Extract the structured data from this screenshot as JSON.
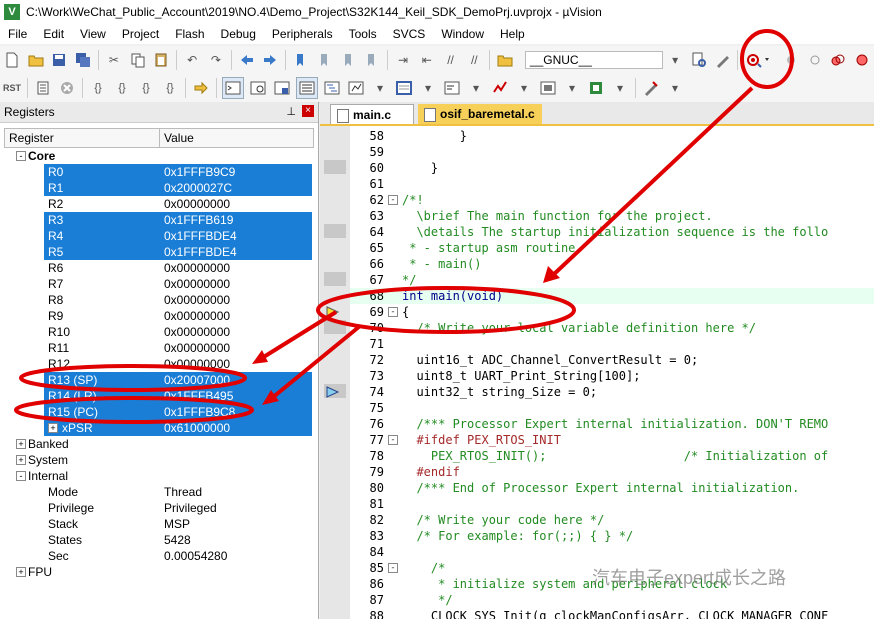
{
  "window": {
    "title": "C:\\Work\\WeChat_Public_Account\\2019\\NO.4\\Demo_Project\\S32K144_Keil_SDK_DemoPrj.uvprojx - µVision"
  },
  "menu": [
    "File",
    "Edit",
    "View",
    "Project",
    "Flash",
    "Debug",
    "Peripherals",
    "Tools",
    "SVCS",
    "Window",
    "Help"
  ],
  "toolbar": {
    "target_value": "__GNUC__"
  },
  "registers_pane": {
    "title": "Registers",
    "columns": {
      "register": "Register",
      "value": "Value"
    },
    "core_label": "Core",
    "core": [
      {
        "name": "R0",
        "value": "0x1FFFB9C9",
        "selected": true
      },
      {
        "name": "R1",
        "value": "0x2000027C",
        "selected": true
      },
      {
        "name": "R2",
        "value": "0x00000000",
        "selected": false
      },
      {
        "name": "R3",
        "value": "0x1FFFB619",
        "selected": true
      },
      {
        "name": "R4",
        "value": "0x1FFFBDE4",
        "selected": true
      },
      {
        "name": "R5",
        "value": "0x1FFFBDE4",
        "selected": true
      },
      {
        "name": "R6",
        "value": "0x00000000",
        "selected": false
      },
      {
        "name": "R7",
        "value": "0x00000000",
        "selected": false
      },
      {
        "name": "R8",
        "value": "0x00000000",
        "selected": false
      },
      {
        "name": "R9",
        "value": "0x00000000",
        "selected": false
      },
      {
        "name": "R10",
        "value": "0x00000000",
        "selected": false
      },
      {
        "name": "R11",
        "value": "0x00000000",
        "selected": false
      },
      {
        "name": "R12",
        "value": "0x00000000",
        "selected": false
      },
      {
        "name": "R13 (SP)",
        "value": "0x20007000",
        "selected": true
      },
      {
        "name": "R14 (LR)",
        "value": "0x1FFFB495",
        "selected": true
      },
      {
        "name": "R15 (PC)",
        "value": "0x1FFFB9C8",
        "selected": true
      },
      {
        "name": "xPSR",
        "value": "0x61000000",
        "selected": true
      }
    ],
    "groups": [
      "Banked",
      "System",
      "Internal"
    ],
    "internal": [
      {
        "name": "Mode",
        "value": "Thread"
      },
      {
        "name": "Privilege",
        "value": "Privileged"
      },
      {
        "name": "Stack",
        "value": "MSP"
      },
      {
        "name": "States",
        "value": "5428"
      },
      {
        "name": "Sec",
        "value": "0.00054280"
      }
    ],
    "fpu_label": "FPU"
  },
  "editor": {
    "tabs": [
      {
        "label": "main.c",
        "active": true
      },
      {
        "label": "osif_baremetal.c",
        "active": false
      }
    ],
    "lines": [
      {
        "n": "58",
        "text": "        }",
        "cls": ""
      },
      {
        "n": "59",
        "text": "",
        "cls": ""
      },
      {
        "n": "60",
        "text": "    }",
        "cls": ""
      },
      {
        "n": "61",
        "text": "",
        "cls": ""
      },
      {
        "n": "62",
        "text": "/*!",
        "cls": "com",
        "fold": "-"
      },
      {
        "n": "63",
        "text": "  \\brief The main function for the project.",
        "cls": "com"
      },
      {
        "n": "64",
        "text": "  \\details The startup initialization sequence is the follo",
        "cls": "com"
      },
      {
        "n": "65",
        "text": " * - startup asm routine",
        "cls": "com"
      },
      {
        "n": "66",
        "text": " * - main()",
        "cls": "com"
      },
      {
        "n": "67",
        "text": "*/",
        "cls": "com"
      },
      {
        "n": "68",
        "text": "int main(void)",
        "cls": "kw",
        "hl": true
      },
      {
        "n": "69",
        "text": "{",
        "cls": "",
        "fold": "-"
      },
      {
        "n": "70",
        "text": "  /* Write your local variable definition here */",
        "cls": "com"
      },
      {
        "n": "71",
        "text": "",
        "cls": ""
      },
      {
        "n": "72",
        "text": "  uint16_t ADC_Channel_ConvertResult = 0;",
        "cls": ""
      },
      {
        "n": "73",
        "text": "  uint8_t UART_Print_String[100];",
        "cls": ""
      },
      {
        "n": "74",
        "text": "  uint32_t string_Size = 0;",
        "cls": ""
      },
      {
        "n": "75",
        "text": "",
        "cls": ""
      },
      {
        "n": "76",
        "text": "  /*** Processor Expert internal initialization. DON'T REMO",
        "cls": "com"
      },
      {
        "n": "77",
        "text": "  #ifdef PEX_RTOS_INIT",
        "cls": "pre",
        "fold": "-"
      },
      {
        "n": "78",
        "text": "    PEX_RTOS_INIT();                   /* Initialization of",
        "cls": "com"
      },
      {
        "n": "79",
        "text": "  #endif",
        "cls": "pre"
      },
      {
        "n": "80",
        "text": "  /*** End of Processor Expert internal initialization.",
        "cls": "com"
      },
      {
        "n": "81",
        "text": "",
        "cls": ""
      },
      {
        "n": "82",
        "text": "  /* Write your code here */",
        "cls": "com"
      },
      {
        "n": "83",
        "text": "  /* For example: for(;;) { } */",
        "cls": "com"
      },
      {
        "n": "84",
        "text": "",
        "cls": ""
      },
      {
        "n": "85",
        "text": "    /*",
        "cls": "com",
        "fold": "-"
      },
      {
        "n": "86",
        "text": "     * initialize system and peripheral clock",
        "cls": "com"
      },
      {
        "n": "87",
        "text": "     */",
        "cls": "com"
      },
      {
        "n": "88",
        "text": "    CLOCK_SYS_Init(g_clockManConfigsArr, CLOCK_MANAGER_CONF",
        "cls": ""
      }
    ]
  },
  "watermark": "汽车电子expert成长之路",
  "colors": {
    "selection": "#1a7ed6",
    "annotation": "#e00000",
    "comment": "#228b22"
  }
}
